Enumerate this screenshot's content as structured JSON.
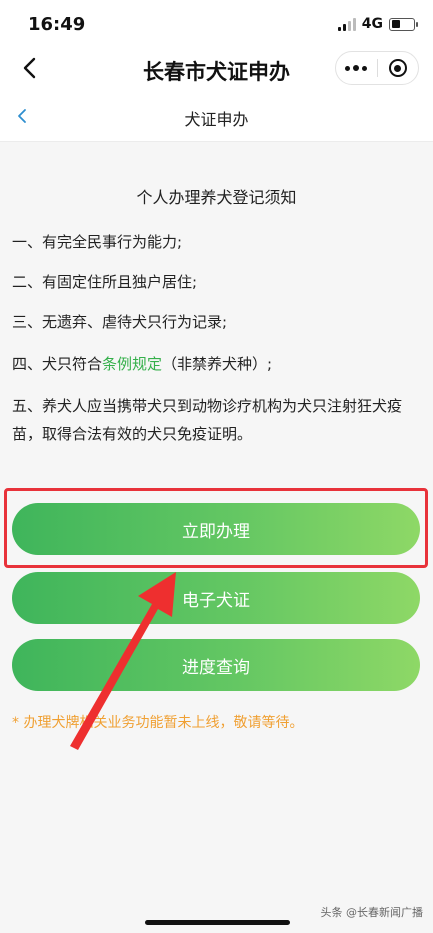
{
  "status_bar": {
    "time": "16:49",
    "network": "4G"
  },
  "nav": {
    "title": "长春市犬证申办",
    "back_icon": "chevron-left-icon",
    "more_icon": "more-dots-icon",
    "close_icon": "target-circle-icon"
  },
  "sub_header": {
    "title": "犬证申办",
    "back_icon": "chevron-left-icon",
    "accent_color": "#2e8ecf"
  },
  "notice": {
    "title": "个人办理养犬登记须知",
    "items": [
      "一、有完全民事行为能力;",
      "二、有固定住所且独户居住;",
      "三、无遗弃、虐待犬只行为记录;",
      "五、养犬人应当携带犬只到动物诊疗机构为犬只注射狂犬疫苗，取得合法有效的犬只免疫证明。"
    ],
    "item4": {
      "prefix": "四、犬只符合",
      "link": "条例规定",
      "suffix": "（非禁养犬种）;"
    },
    "link_color": "#35b04b"
  },
  "buttons": {
    "apply": "立即办理",
    "ecert": "电子犬证",
    "progress": "进度查询",
    "gradient": [
      "#3fb55b",
      "#8ed866"
    ]
  },
  "note": "* 办理犬牌相关业务功能暂未上线，敬请等待。",
  "note_color": "#f0a033",
  "highlight_color": "#e8323a",
  "watermark": "头条 @长春新闻广播"
}
